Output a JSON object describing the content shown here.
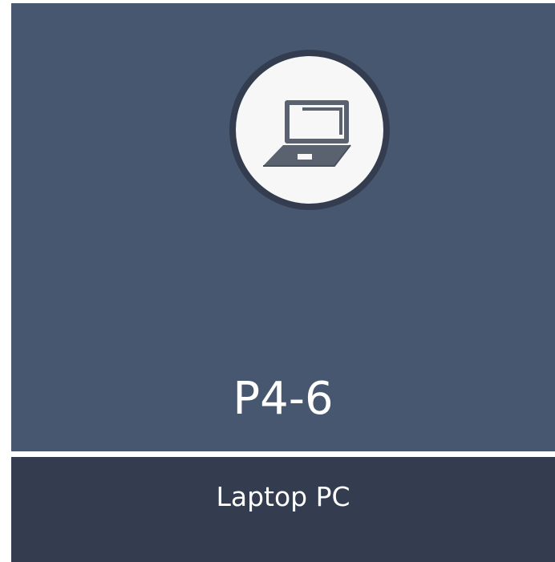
{
  "tile": {
    "code": "P4-6",
    "label": "Laptop PC",
    "icon": "laptop-icon",
    "colors": {
      "top_background": "#485770",
      "bottom_background": "#333d4f",
      "icon_ring": "#333d4f",
      "icon_background": "#f7f7f7",
      "icon_foreground": "#5a6270",
      "text": "#ffffff"
    }
  }
}
